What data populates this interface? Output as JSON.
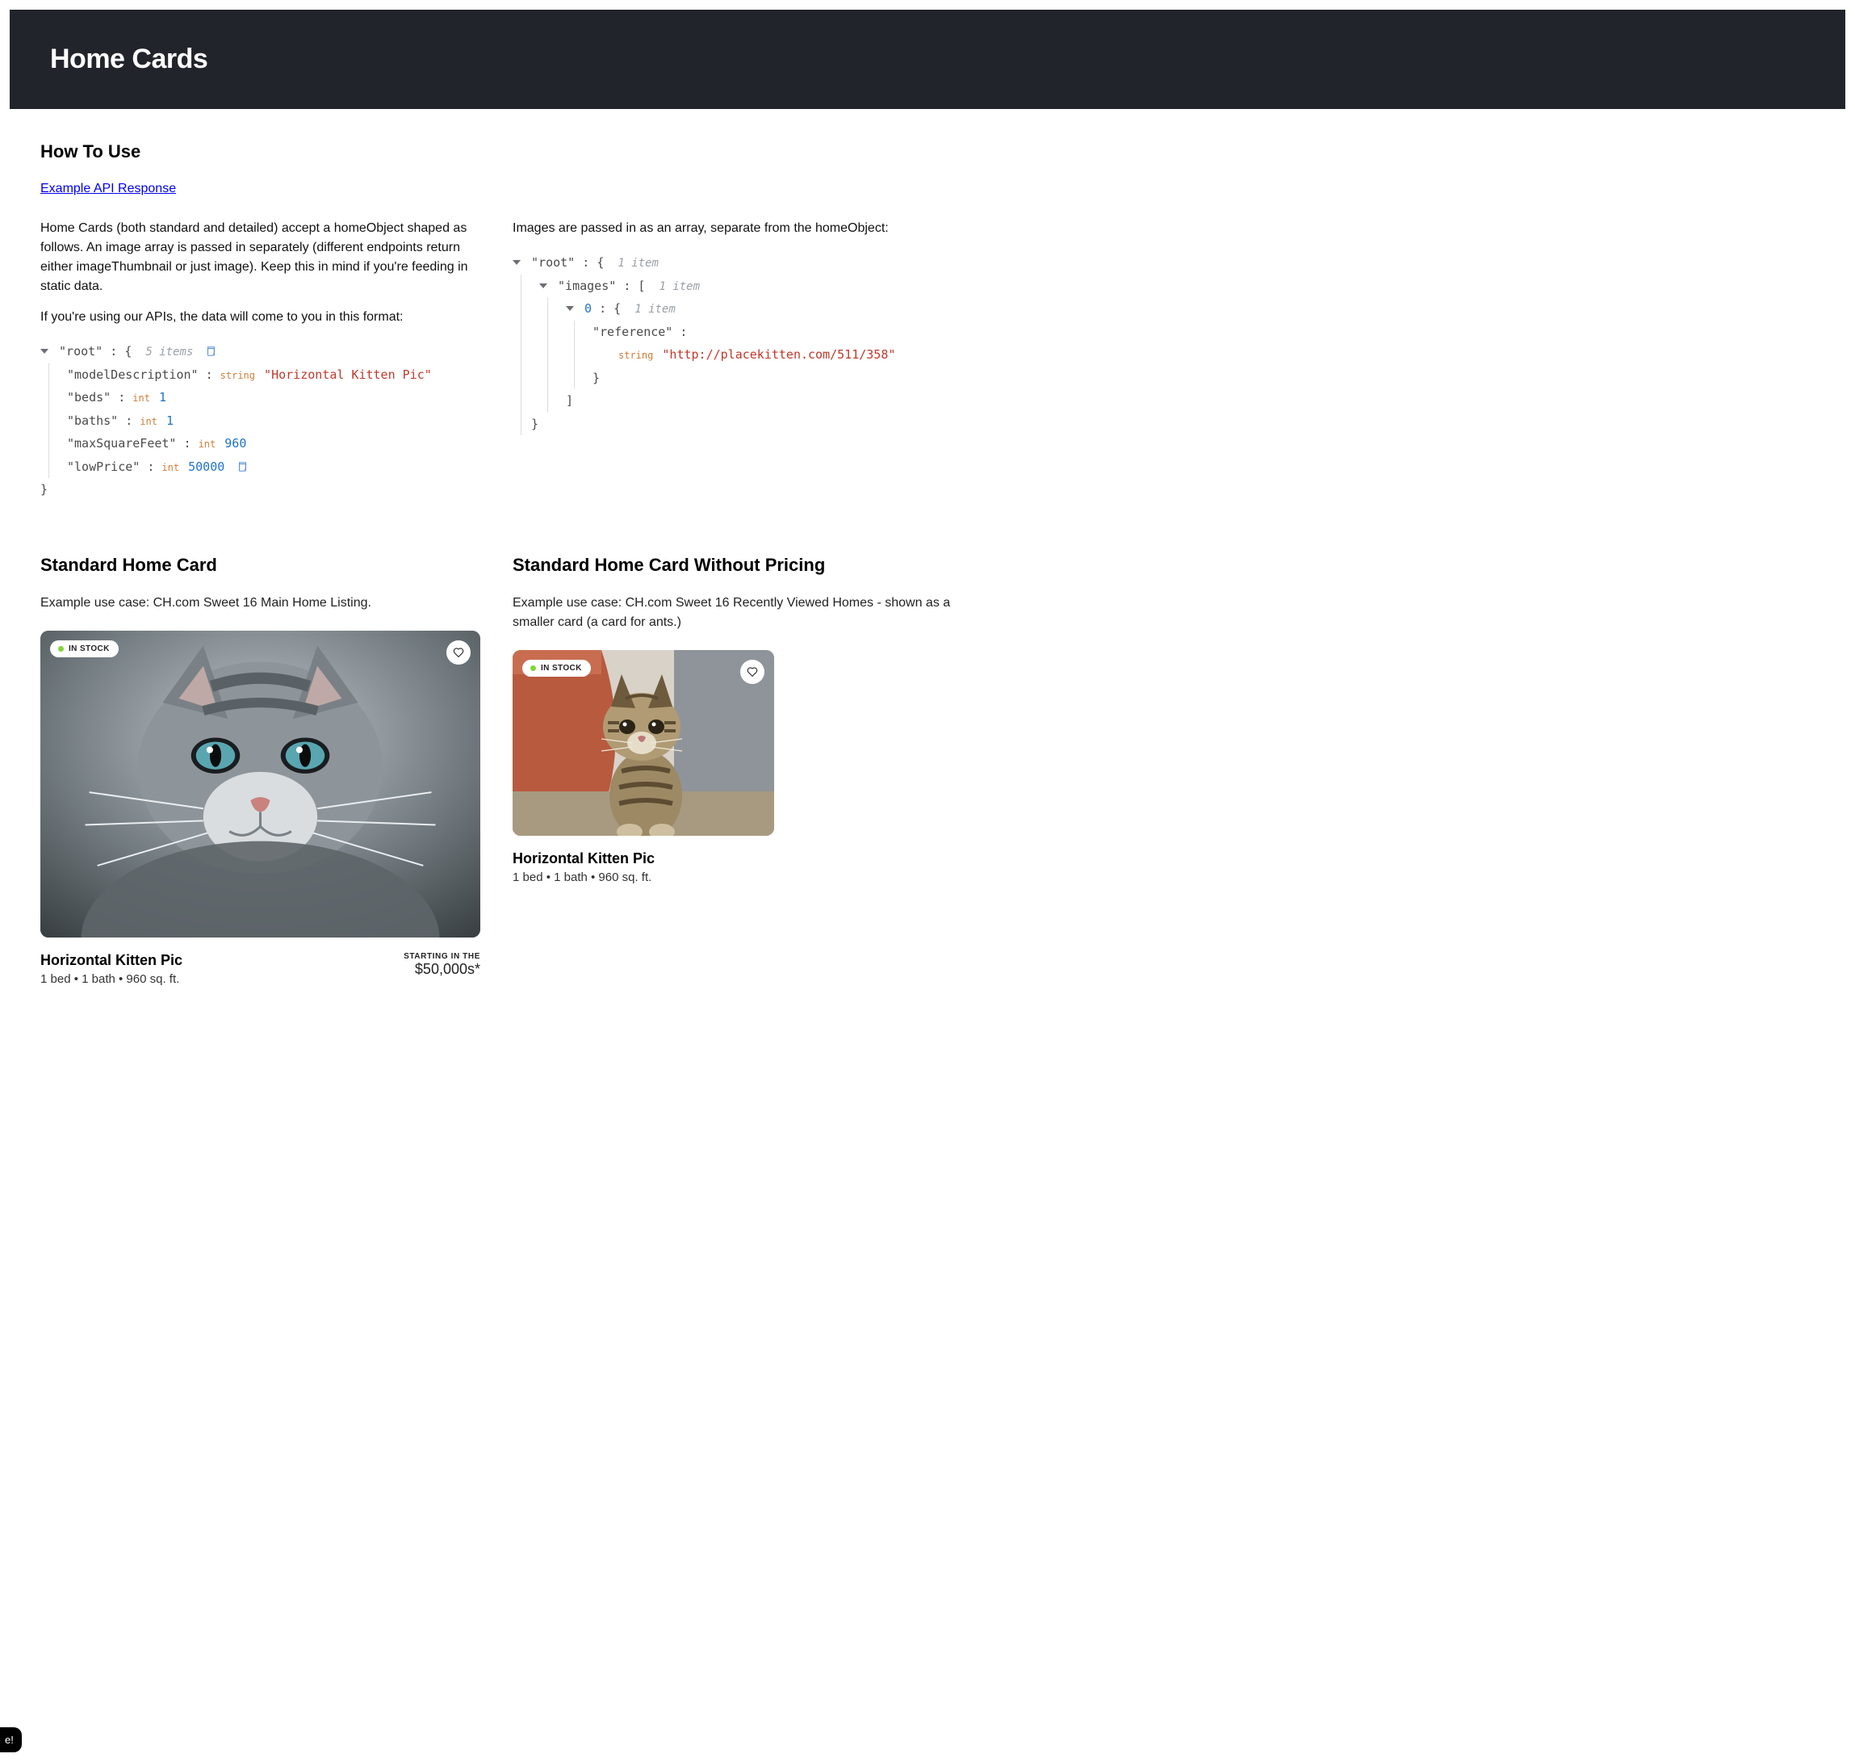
{
  "header": {
    "title": "Home Cards"
  },
  "howto": {
    "heading": "How To Use",
    "api_link_text": "Example API Response",
    "left_para1": "Home Cards (both standard and detailed) accept a homeObject shaped as follows. An image array is passed in separately (different endpoints return either imageThumbnail or just image). Keep this in mind if you're feeding in static data.",
    "left_para2": "If you're using our APIs, the data will come to you in this format:",
    "right_para1": "Images are passed in as an array, separate from the homeObject:"
  },
  "json_left": {
    "root_label": "\"root\"",
    "root_open": "{",
    "root_meta": "5 items",
    "entries": {
      "modelDescription": {
        "key": "\"modelDescription\"",
        "type": "string",
        "value": "\"Horizontal Kitten Pic\""
      },
      "beds": {
        "key": "\"beds\"",
        "type": "int",
        "value": "1"
      },
      "baths": {
        "key": "\"baths\"",
        "type": "int",
        "value": "1"
      },
      "maxSquareFeet": {
        "key": "\"maxSquareFeet\"",
        "type": "int",
        "value": "960"
      },
      "lowPrice": {
        "key": "\"lowPrice\"",
        "type": "int",
        "value": "50000"
      }
    },
    "root_close": "}"
  },
  "json_right": {
    "root_label": "\"root\"",
    "root_open": "{",
    "root_meta": "1 item",
    "images_key": "\"images\"",
    "images_open": "[",
    "images_meta": "1 item",
    "idx0_key": "0",
    "idx0_open": "{",
    "idx0_meta": "1 item",
    "ref_key": "\"reference\"",
    "ref_type": "string",
    "ref_value": "\"http://placekitten.com/511/358\"",
    "idx0_close": "}",
    "images_close": "]",
    "root_close": "}"
  },
  "cards": {
    "standard": {
      "heading": "Standard Home Card",
      "use_case": "Example use case: CH.com Sweet 16 Main Home Listing.",
      "stock_label": "IN STOCK",
      "title": "Horizontal Kitten Pic",
      "specs": "1 bed • 1 bath • 960 sq. ft.",
      "starting_label": "STARTING IN THE",
      "price": "$50,000s*"
    },
    "nopricing": {
      "heading": "Standard Home Card Without Pricing",
      "use_case": "Example use case: CH.com Sweet 16 Recently Viewed Homes - shown as a smaller card (a card for ants.)",
      "stock_label": "IN STOCK",
      "title": "Horizontal Kitten Pic",
      "specs": "1 bed • 1 bath • 960 sq. ft."
    }
  },
  "corner_tab": "e!"
}
